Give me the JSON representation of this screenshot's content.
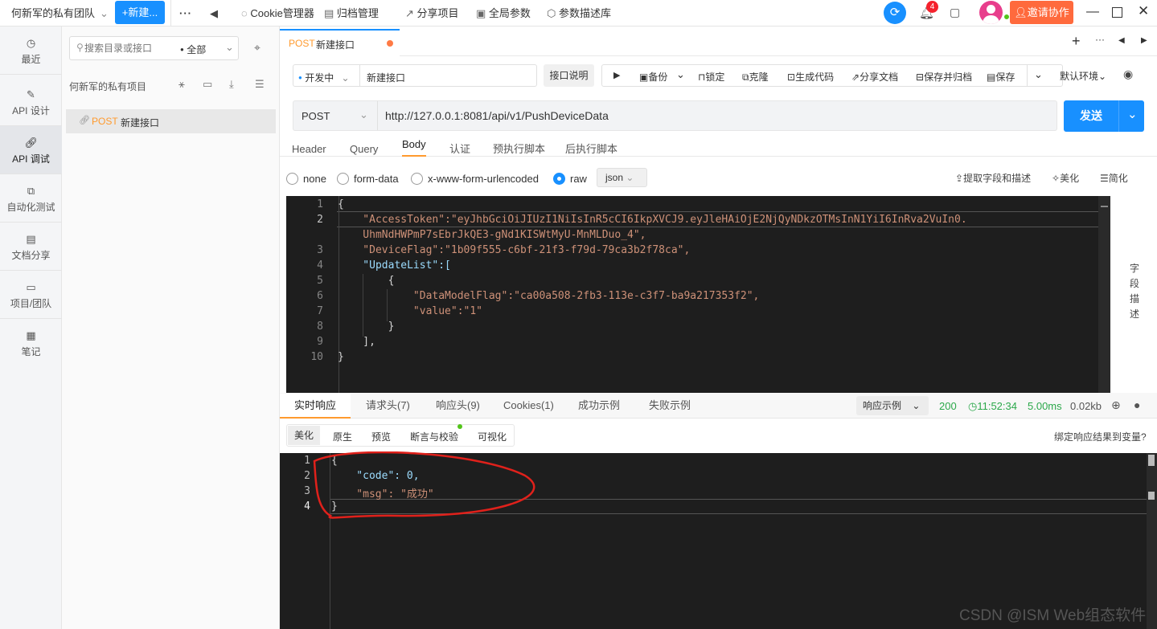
{
  "topbar": {
    "team": "何新军的私有团队",
    "new_btn": "+新建...",
    "more": "···",
    "back": "◀",
    "tools": [
      "Cookie管理器",
      "归档管理",
      "分享项目",
      "全局参数",
      "参数描述库"
    ],
    "bell_count": "4",
    "invite": "邀请协作"
  },
  "leftnav": [
    {
      "label": "最近",
      "icon": "clock-icon"
    },
    {
      "label": "API 设计",
      "icon": "edit-icon"
    },
    {
      "label": "API 调试",
      "icon": "link-icon"
    },
    {
      "label": "自动化测试",
      "icon": "flow-icon"
    },
    {
      "label": "文档分享",
      "icon": "doc-share-icon"
    },
    {
      "label": "项目/团队",
      "icon": "folder-icon"
    },
    {
      "label": "笔记",
      "icon": "note-icon"
    }
  ],
  "tree": {
    "search_placeholder": "搜索目录或接口",
    "filter": "全部",
    "project": "何新军的私有项目",
    "item_method": "POST",
    "item_name": "新建接口"
  },
  "tabbar": {
    "method": "POST",
    "name": "新建接口"
  },
  "toolbar": {
    "env_status": "开发中",
    "api_name": "新建接口",
    "doc_btn": "接口说明",
    "backup": "备份",
    "lock": "锁定",
    "clone": "克隆",
    "gen_code": "生成代码",
    "share_doc": "分享文档",
    "save_archive": "保存并归档",
    "save": "保存",
    "env": "默认环境"
  },
  "request": {
    "method": "POST",
    "url": "http://127.0.0.1:8081/api/v1/PushDeviceData",
    "send": "发送"
  },
  "req_tabs": [
    "Header",
    "Query",
    "Body",
    "认证",
    "预执行脚本",
    "后执行脚本"
  ],
  "body_types": [
    "none",
    "form-data",
    "x-www-form-urlencoded",
    "raw"
  ],
  "raw_format": "json",
  "body_actions": [
    "提取字段和描述",
    "美化",
    "简化"
  ],
  "field_desc": [
    "字",
    "段",
    "描",
    "述"
  ],
  "request_body_lines": [
    "{",
    "    \"AccessToken\":\"eyJhbGciOiJIUzI1NiIsInR5cCI6IkpXVCJ9.eyJleHAiOjE2NjQyNDkzOTMsInN1YiI6InRva2VuIn0.",
    "    UhmNdHWPmP7sEbrJkQE3-gNd1KISWtMyU-MnMLDuo_4\",",
    "    \"DeviceFlag\":\"1b09f555-c6bf-21f3-f79d-79ca3b2f78ca\",",
    "    \"UpdateList\":[",
    "        {",
    "            \"DataModelFlag\":\"ca00a508-2fb3-113e-c3f7-ba9a217353f2\",",
    "            \"value\":\"1\"",
    "        }",
    "    ],",
    "}"
  ],
  "resp_tabs": [
    "实时响应",
    "请求头(7)",
    "响应头(9)",
    "Cookies(1)",
    "成功示例",
    "失败示例"
  ],
  "resp_status": {
    "example": "响应示例",
    "code": "200",
    "time": "11:52:34",
    "duration": "5.00ms",
    "size": "0.02kb"
  },
  "resp_view_tabs": [
    "美化",
    "原生",
    "预览",
    "断言与校验",
    "可视化"
  ],
  "bind_link": "绑定响应结果到变量?",
  "response_lines": [
    "{",
    "    \"code\": 0,",
    "    \"msg\": \"成功\"",
    "}"
  ],
  "watermark": "CSDN @ISM Web组态软件",
  "colors": {
    "accent": "#1890ff",
    "orange": "#ff9a2e",
    "invite": "#ff6a3d",
    "editor_bg": "#1e1e1e",
    "annotation": "#e0211b"
  }
}
